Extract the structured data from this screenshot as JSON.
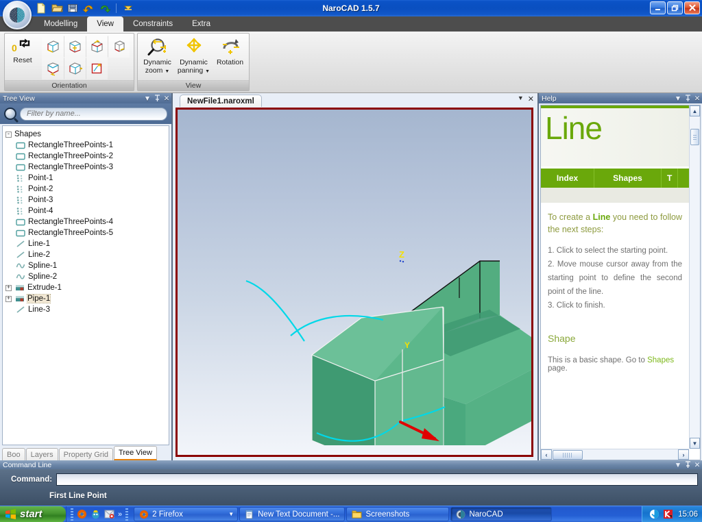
{
  "window": {
    "title": "NaroCAD 1.5.7",
    "minimize_label": "Minimize",
    "restore_label": "Restore",
    "close_label": "Close"
  },
  "quick_access": {
    "items": [
      {
        "name": "new-file-icon",
        "label": "New"
      },
      {
        "name": "open-file-icon",
        "label": "Open"
      },
      {
        "name": "save-file-icon",
        "label": "Save"
      },
      {
        "name": "undo-icon",
        "label": "Undo"
      },
      {
        "name": "redo-icon",
        "label": "Redo"
      },
      {
        "name": "customize-toolbar-icon",
        "label": "Customize Quick Access Toolbar"
      }
    ]
  },
  "ribbon": {
    "tabs": [
      {
        "label": "Modelling",
        "active": false
      },
      {
        "label": "View",
        "active": true
      },
      {
        "label": "Constraints",
        "active": false
      },
      {
        "label": "Extra",
        "active": false
      }
    ],
    "groups": [
      {
        "label": "Orientation",
        "reset_label": "Reset",
        "orientation_buttons": [
          "front-view-icon",
          "back-view-icon",
          "top-view-icon",
          "bottom-view-icon",
          "left-view-icon",
          "right-view-icon",
          "axonometric-view-icon"
        ]
      },
      {
        "label": "View",
        "buttons": [
          {
            "label": "Dynamic\nzoom",
            "line1": "Dynamic",
            "line2": "zoom",
            "dropdown": true,
            "icon": "dynamic-zoom-icon"
          },
          {
            "label": "Dynamic\npanning",
            "line1": "Dynamic",
            "line2": "panning",
            "dropdown": true,
            "icon": "dynamic-panning-icon"
          },
          {
            "label": "Rotation",
            "line1": "Rotation",
            "line2": "",
            "dropdown": false,
            "icon": "rotation-icon"
          }
        ]
      }
    ]
  },
  "tree_view": {
    "title": "Tree View",
    "filter_placeholder": "Filter by name...",
    "filter_value": "",
    "root": {
      "label": "Shapes",
      "expander": "-"
    },
    "items": [
      {
        "label": "RectangleThreePoints-1",
        "icon": "rectangle-icon",
        "expander": "",
        "selected": false
      },
      {
        "label": "RectangleThreePoints-2",
        "icon": "rectangle-icon",
        "expander": "",
        "selected": false
      },
      {
        "label": "RectangleThreePoints-3",
        "icon": "rectangle-icon",
        "expander": "",
        "selected": false
      },
      {
        "label": "Point-1",
        "icon": "point-icon",
        "expander": "",
        "selected": false
      },
      {
        "label": "Point-2",
        "icon": "point-icon",
        "expander": "",
        "selected": false
      },
      {
        "label": "Point-3",
        "icon": "point-icon",
        "expander": "",
        "selected": false
      },
      {
        "label": "Point-4",
        "icon": "point-icon",
        "expander": "",
        "selected": false
      },
      {
        "label": "RectangleThreePoints-4",
        "icon": "rectangle-icon",
        "expander": "",
        "selected": false
      },
      {
        "label": "RectangleThreePoints-5",
        "icon": "rectangle-icon",
        "expander": "",
        "selected": false
      },
      {
        "label": "Line-1",
        "icon": "line-icon",
        "expander": "",
        "selected": false
      },
      {
        "label": "Line-2",
        "icon": "line-icon",
        "expander": "",
        "selected": false
      },
      {
        "label": "Spline-1",
        "icon": "spline-icon",
        "expander": "",
        "selected": false
      },
      {
        "label": "Spline-2",
        "icon": "spline-icon",
        "expander": "",
        "selected": false
      },
      {
        "label": "Extrude-1",
        "icon": "solid-icon",
        "expander": "+",
        "selected": false
      },
      {
        "label": "Pipe-1",
        "icon": "solid-icon",
        "expander": "+",
        "selected": true
      },
      {
        "label": "Line-3",
        "icon": "line-icon",
        "expander": "",
        "selected": false
      }
    ],
    "tabs": [
      {
        "label": "Boo",
        "active": false
      },
      {
        "label": "Layers",
        "active": false
      },
      {
        "label": "Property Grid",
        "active": false
      },
      {
        "label": "Tree View",
        "active": true
      }
    ]
  },
  "document": {
    "tab_label": "NewFile1.naroxml",
    "viewport": {
      "axis_labels": {
        "z": "Z",
        "y": "Y"
      },
      "border_color": "#8b0000",
      "bg_top": "#a5b6cf",
      "bg_bottom": "#f2f5fa",
      "solid_color": "#53b083",
      "highlight_color": "#00d4e8",
      "arrow_color": "#e00000"
    }
  },
  "help": {
    "title": "Help",
    "hero_title": "Line",
    "nav": [
      "Index",
      "Shapes",
      "T"
    ],
    "lead_before": "To create a ",
    "lead_bold": "Line",
    "lead_after": " you need to follow the next steps:",
    "steps": [
      "1. Click to select the starting point.",
      "2. Move mouse cursor away from the starting point to define the second point of the line.",
      "3. Click to finish."
    ],
    "section_title": "Shape",
    "paragraph_before": "This is a basic shape. Go to ",
    "paragraph_link": "Shapes",
    "paragraph_after": " page.",
    "accent_color": "#6aa80b"
  },
  "panel_buttons": {
    "menu": "▼",
    "pin": "Ψ",
    "close": "✕"
  },
  "command_line": {
    "title": "Command Line",
    "label": "Command:",
    "value": "",
    "placeholder": "",
    "status": "First Line Point"
  },
  "taskbar": {
    "start_label": "start",
    "quick_launch": [
      {
        "name": "firefox-quicklaunch-icon",
        "label": "Firefox"
      },
      {
        "name": "emule-quicklaunch-icon",
        "label": "eMule"
      },
      {
        "name": "outlook-quicklaunch-icon",
        "label": "Mail"
      },
      {
        "name": "quicklaunch-overflow-icon",
        "label": "»"
      }
    ],
    "tasks": [
      {
        "label": "2 Firefox",
        "icon": "firefox-icon",
        "active": false,
        "has_caret": true
      },
      {
        "label": "New Text Document -...",
        "icon": "notepad-icon",
        "active": false,
        "has_caret": false
      },
      {
        "label": "Screenshots",
        "icon": "folder-icon",
        "active": false,
        "has_caret": false
      },
      {
        "label": "NaroCAD",
        "icon": "narocad-icon",
        "active": true,
        "has_caret": false
      }
    ],
    "tray": [
      {
        "name": "messenger-tray-icon",
        "label": "Messenger"
      },
      {
        "name": "kaspersky-tray-icon",
        "label": "Kaspersky"
      }
    ],
    "clock": "15:06"
  }
}
